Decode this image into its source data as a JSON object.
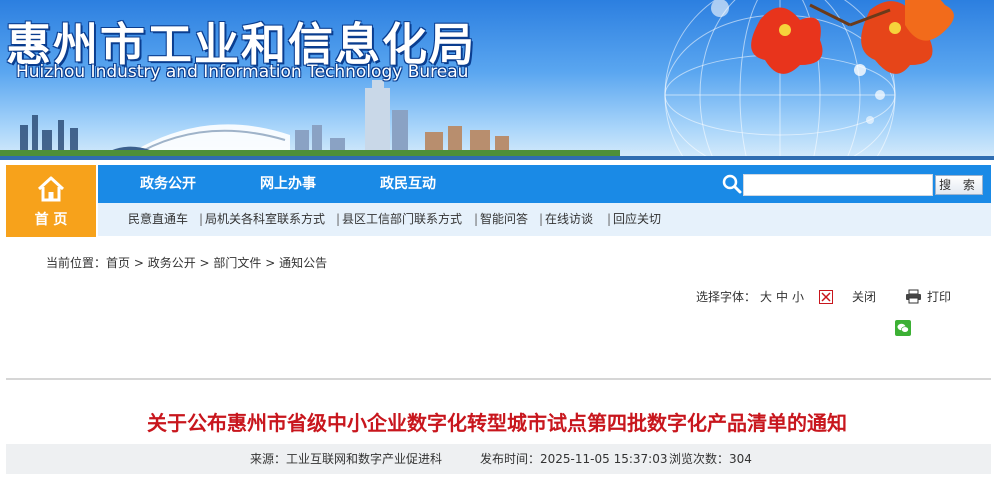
{
  "banner": {
    "title_cn": "惠州市工业和信息化局",
    "title_en": "Huizhou Industry and Information Technology Bureau"
  },
  "nav": {
    "home_label": "首 页",
    "home_icon": "home-icon",
    "main_items": [
      {
        "label": "政务公开"
      },
      {
        "label": "网上办事"
      },
      {
        "label": "政民互动"
      }
    ],
    "sub_items": [
      {
        "label": "民意直通车"
      },
      {
        "label": "局机关各科室联系方式"
      },
      {
        "label": "县区工信部门联系方式"
      },
      {
        "label": "智能问答"
      },
      {
        "label": "在线访谈"
      },
      {
        "label": "回应关切"
      }
    ],
    "separator": "|",
    "accent_color": "#1a8ae6",
    "home_color": "#f7a21b"
  },
  "search": {
    "placeholder": "",
    "button_label": "搜 索",
    "icon": "search-icon"
  },
  "breadcrumb": {
    "prefix": "当前位置：",
    "items": [
      "首页",
      "政务公开",
      "部门文件",
      "通知公告"
    ],
    "separator": " > "
  },
  "tools": {
    "font_label": "选择字体：",
    "font_sizes": [
      "大",
      "中",
      "小"
    ],
    "close_label": "关闭",
    "print_label": "打印",
    "close_icon": "close-icon",
    "print_icon": "print-icon",
    "share_icon": "wechat-icon"
  },
  "article": {
    "title": "关于公布惠州市省级中小企业数字化转型城市试点第四批数字化产品清单的通知",
    "title_color": "#c8161d",
    "source_label": "来源：",
    "source": "工业互联网和数字产业促进科",
    "time_label": "发布时间：",
    "time": "2025-11-05 15:37:03",
    "views_label": "浏览次数：",
    "views": "304"
  }
}
